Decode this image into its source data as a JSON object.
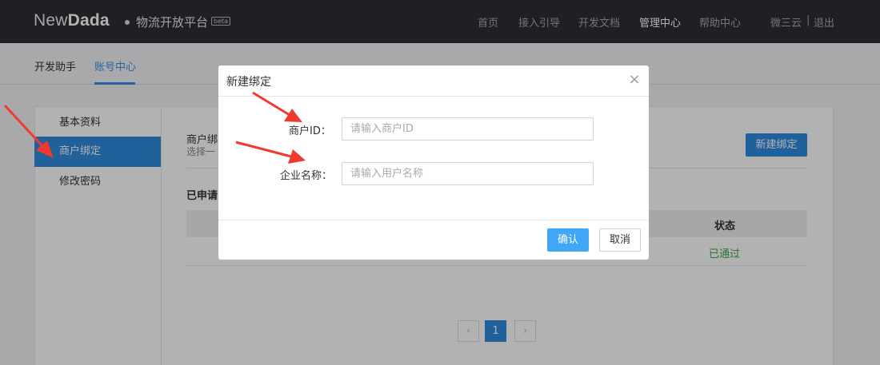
{
  "header": {
    "logo_thin": "New",
    "logo_bold": "Dada",
    "platform": "物流开放平台",
    "beta": "beta",
    "nav": [
      {
        "label": "首页"
      },
      {
        "label": "接入引导"
      },
      {
        "label": "开发文档"
      },
      {
        "label": "管理中心"
      },
      {
        "label": "帮助中心"
      }
    ],
    "user": "微三云",
    "separator": "|",
    "logout": "退出"
  },
  "subnav": {
    "tabs": [
      {
        "label": "开发助手"
      },
      {
        "label": "账号中心"
      }
    ]
  },
  "sidebar": {
    "items": [
      {
        "label": "基本资料"
      },
      {
        "label": "商户绑定"
      },
      {
        "label": "修改密码"
      }
    ]
  },
  "content": {
    "title": "商户绑",
    "subtitle": "选择一",
    "new_bind_button": "新建绑定",
    "applied_title": "已申请",
    "table": {
      "status_header": "状态",
      "rows": [
        {
          "status": "已通过"
        }
      ]
    },
    "pagination": {
      "prev": "‹",
      "current": "1",
      "next": "›"
    }
  },
  "dialog": {
    "title": "新建绑定",
    "close": "×",
    "merchant_id_label": "商户ID：",
    "merchant_id_placeholder": "请输入商户ID",
    "merchant_id_value": "",
    "company_name_label": "企业名称：",
    "company_name_placeholder": "请输入用户名称",
    "company_name_value": "",
    "confirm": "确认",
    "cancel": "取消"
  },
  "colors": {
    "topbar": "#2d2e33",
    "accent": "#2f8be0",
    "confirm": "#3fa7f5",
    "success": "#38a54a",
    "annotation_arrow": "#f03a2e"
  }
}
